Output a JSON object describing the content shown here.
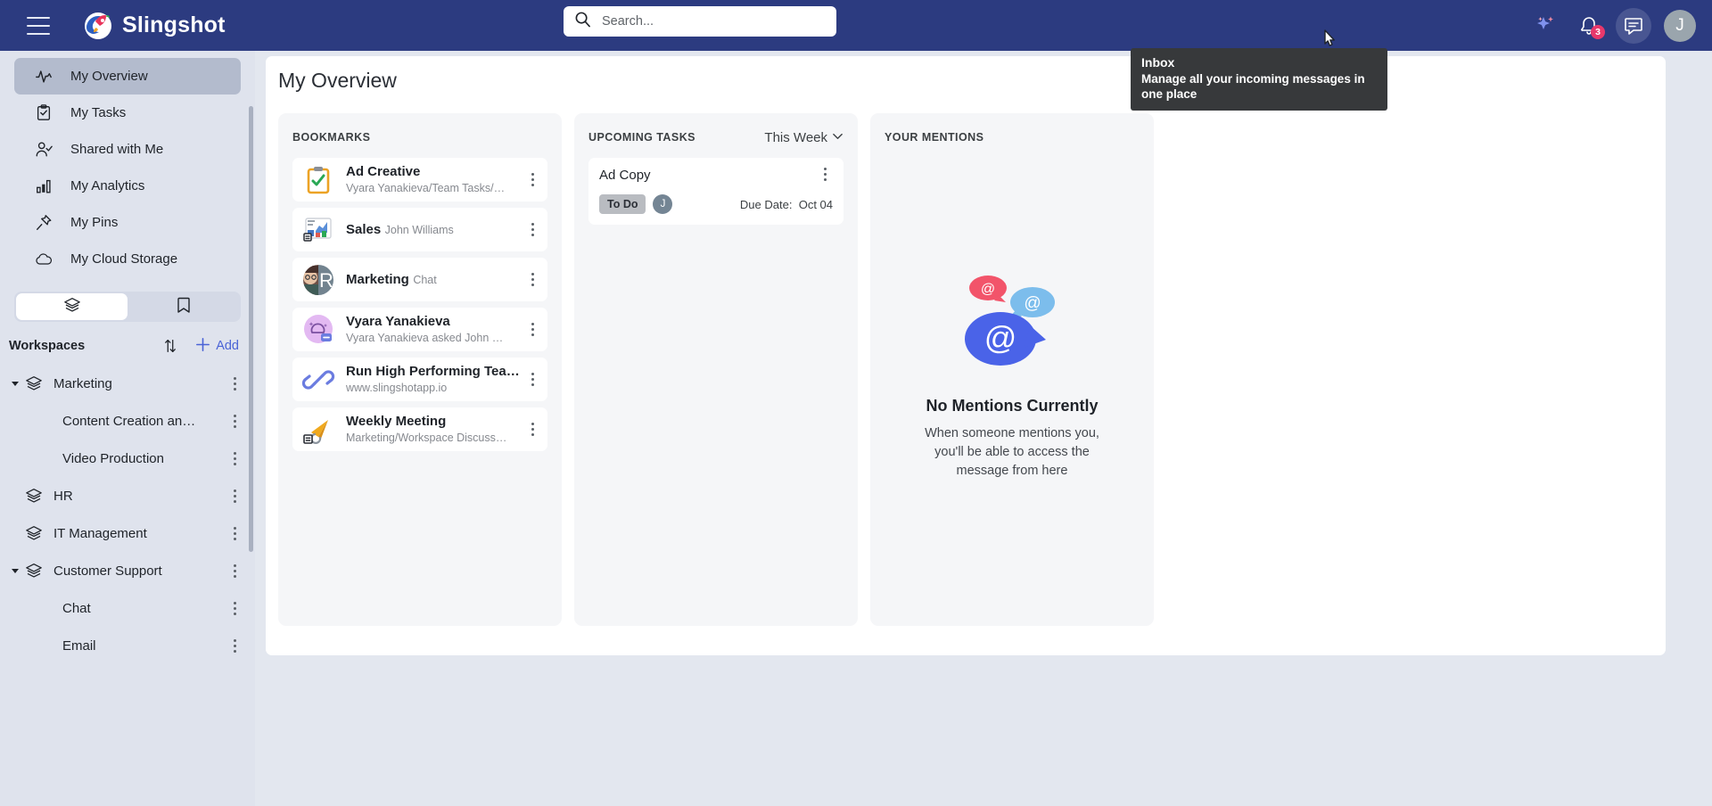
{
  "app": {
    "brand_name": "Slingshot",
    "menu_icon": "hamburger-icon",
    "logo_icon": "rocket-logo-icon"
  },
  "search": {
    "placeholder": "Search...",
    "value": "",
    "icon": "search-icon"
  },
  "topbar": {
    "ai_icon": "sparkle-icon",
    "notifications_icon": "bell-icon",
    "notifications_count": "3",
    "inbox_icon": "inbox-message-icon",
    "avatar_initial": "J"
  },
  "tooltip": {
    "title": "Inbox",
    "body": "Manage all your incoming messages in one place"
  },
  "sidebar": {
    "nav": [
      {
        "label": "My Overview",
        "icon": "activity-pulse-icon",
        "selected": true
      },
      {
        "label": "My Tasks",
        "icon": "clipboard-check-icon",
        "selected": false
      },
      {
        "label": "Shared with Me",
        "icon": "user-check-icon",
        "selected": false
      },
      {
        "label": "My Analytics",
        "icon": "bar-chart-icon",
        "selected": false
      },
      {
        "label": "My Pins",
        "icon": "pin-icon",
        "selected": false
      },
      {
        "label": "My Cloud Storage",
        "icon": "cloud-icon",
        "selected": false
      }
    ],
    "segments": [
      {
        "icon": "layers-icon",
        "active": true
      },
      {
        "icon": "bookmark-icon",
        "active": false
      }
    ],
    "workspaces_title": "Workspaces",
    "sort_icon": "sort-arrows-icon",
    "add_label": "Add",
    "add_icon": "plus-icon",
    "workspaces": [
      {
        "label": "Marketing",
        "level": 0,
        "expanded": true,
        "icon": "layers-icon"
      },
      {
        "label": "Content Creation an…",
        "level": 1,
        "expanded": false,
        "icon": ""
      },
      {
        "label": "Video Production",
        "level": 1,
        "expanded": false,
        "icon": ""
      },
      {
        "label": "HR",
        "level": 0,
        "expanded": false,
        "icon": "layers-icon"
      },
      {
        "label": "IT Management",
        "level": 0,
        "expanded": false,
        "icon": "layers-icon"
      },
      {
        "label": "Customer Support",
        "level": 0,
        "expanded": true,
        "icon": "layers-icon"
      },
      {
        "label": "Chat",
        "level": 1,
        "expanded": false,
        "icon": ""
      },
      {
        "label": "Email",
        "level": 1,
        "expanded": false,
        "icon": ""
      }
    ]
  },
  "main": {
    "page_title": "My Overview",
    "bookmarks": {
      "title": "BOOKMARKS",
      "items": [
        {
          "title": "Ad Creative",
          "subtitle": "Vyara Yanakieva/Team Tasks/…",
          "icon": "clipboard-task-icon"
        },
        {
          "title": "Sales",
          "subtitle": "John Williams",
          "icon": "spreadsheet-chart-icon"
        },
        {
          "title": "Marketing",
          "subtitle": "Chat",
          "icon": "chat-avatar-icon"
        },
        {
          "title": "Vyara Yanakieva",
          "subtitle": "Vyara Yanakieva asked John …",
          "icon": "question-bubble-icon"
        },
        {
          "title": "Run High Performing Tea…",
          "subtitle": "www.slingshotapp.io",
          "icon": "link-icon"
        },
        {
          "title": "Weekly Meeting",
          "subtitle": "Marketing/Workspace Discuss…",
          "icon": "megaphone-icon"
        }
      ]
    },
    "tasks": {
      "title": "UPCOMING TASKS",
      "filter_label": "This Week",
      "filter_icon": "chevron-down-icon",
      "items": [
        {
          "name": "Ad Copy",
          "status": "To Do",
          "assignee_initial": "J",
          "due_label": "Due Date:",
          "due_value": "Oct 04",
          "menu_icon": "kebab-menu-icon"
        }
      ]
    },
    "mentions": {
      "title": "YOUR MENTIONS",
      "empty_illustration": "at-mention-bubbles-icon",
      "empty_title": "No Mentions Currently",
      "empty_subtitle": "When someone mentions you, you'll be able to access the message from here"
    }
  },
  "colors": {
    "topbar": "#2c3b80",
    "sidebar": "#dfe3ed",
    "accent": "#4a63d6",
    "badge": "#e8386b",
    "panel_bg": "#f5f6f8"
  }
}
